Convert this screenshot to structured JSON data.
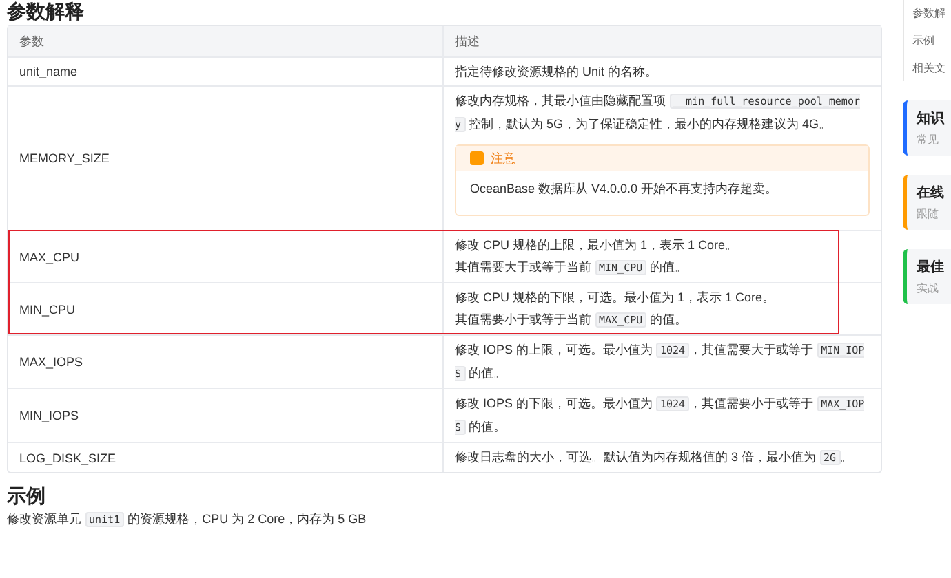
{
  "heading": "参数解释",
  "table": {
    "columns": [
      "参数",
      "描述"
    ],
    "rows": [
      {
        "param": "unit_name",
        "highlighted": false,
        "description": [
          {
            "kind": "text",
            "text": "指定待修改资源规格的 Unit 的名称。"
          }
        ]
      },
      {
        "param": "MEMORY_SIZE",
        "highlighted": false,
        "description": [
          {
            "kind": "text",
            "text": "修改内存规格，其最小值由隐藏配置项 "
          },
          {
            "kind": "code",
            "text": "__min_full_resource_pool_memory"
          },
          {
            "kind": "text",
            "text": " 控制，默认为 5G，为了保证稳定性，最小的内存规格建议为 4G。"
          }
        ],
        "notice": {
          "title": "注意",
          "text": "OceanBase 数据库从 V4.0.0.0 开始不再支持内存超卖。"
        }
      },
      {
        "param": "MAX_CPU",
        "highlighted": true,
        "description": [
          {
            "kind": "text",
            "text": "修改 CPU 规格的上限，最小值为 1，表示 1 Core。"
          },
          {
            "kind": "break"
          },
          {
            "kind": "text",
            "text": "其值需要大于或等于当前 "
          },
          {
            "kind": "code",
            "text": "MIN_CPU"
          },
          {
            "kind": "text",
            "text": " 的值。"
          }
        ]
      },
      {
        "param": "MIN_CPU",
        "highlighted": true,
        "description": [
          {
            "kind": "text",
            "text": "修改 CPU 规格的下限，可选。最小值为 1，表示 1 Core。"
          },
          {
            "kind": "break"
          },
          {
            "kind": "text",
            "text": "其值需要小于或等于当前 "
          },
          {
            "kind": "code",
            "text": "MAX_CPU"
          },
          {
            "kind": "text",
            "text": " 的值。"
          }
        ]
      },
      {
        "param": "MAX_IOPS",
        "highlighted": false,
        "description": [
          {
            "kind": "text",
            "text": "修改 IOPS 的上限，可选。最小值为 "
          },
          {
            "kind": "code",
            "text": "1024"
          },
          {
            "kind": "text",
            "text": "，其值需要大于或等于 "
          },
          {
            "kind": "code",
            "text": "MIN_IOPS"
          },
          {
            "kind": "text",
            "text": " 的值。"
          }
        ]
      },
      {
        "param": "MIN_IOPS",
        "highlighted": false,
        "description": [
          {
            "kind": "text",
            "text": "修改 IOPS 的下限，可选。最小值为 "
          },
          {
            "kind": "code",
            "text": "1024"
          },
          {
            "kind": "text",
            "text": "，其值需要小于或等于 "
          },
          {
            "kind": "code",
            "text": "MAX_IOPS"
          },
          {
            "kind": "text",
            "text": " 的值。"
          }
        ]
      },
      {
        "param": "LOG_DISK_SIZE",
        "highlighted": false,
        "description": [
          {
            "kind": "text",
            "text": "修改日志盘的大小，可选。默认值为内存规格值的 3 倍，最小值为 "
          },
          {
            "kind": "code",
            "text": "2G"
          },
          {
            "kind": "text",
            "text": "。"
          }
        ]
      }
    ]
  },
  "example": {
    "heading": "示例",
    "text": [
      {
        "kind": "text",
        "text": "修改资源单元 "
      },
      {
        "kind": "code",
        "text": "unit1"
      },
      {
        "kind": "text",
        "text": " 的资源规格，CPU 为 2 Core，内存为 5 GB"
      }
    ]
  },
  "sidebar": {
    "links": [
      "参数解",
      "示例",
      "相关文"
    ],
    "cards": [
      {
        "title": "知识",
        "subtitle": "常见",
        "color": "#1f6bff"
      },
      {
        "title": "在线",
        "subtitle": "跟随",
        "color": "#ff9a00"
      },
      {
        "title": "最佳",
        "subtitle": "实战",
        "color": "#1fc14a"
      }
    ]
  }
}
